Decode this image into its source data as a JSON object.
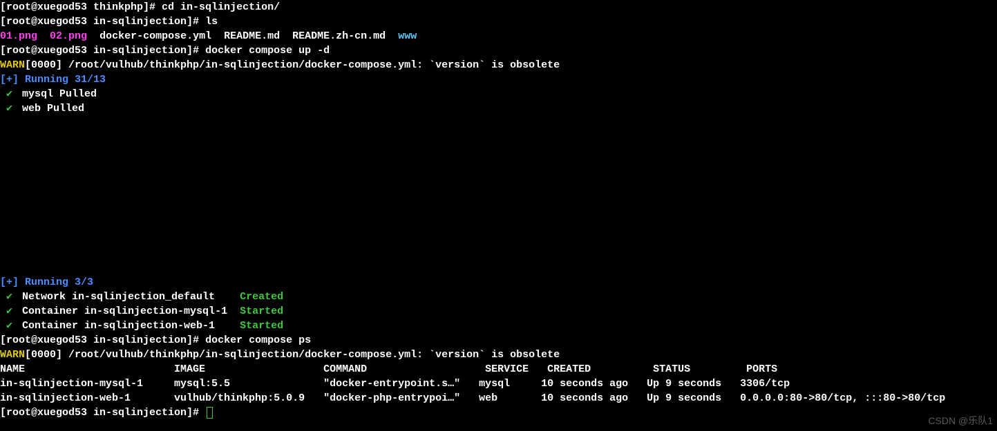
{
  "lines": {
    "l1_prompt": "[root@xuegod53 thinkphp]# ",
    "l1_cmd": "cd in-sqlinjection/",
    "l2_prompt": "[root@xuegod53 in-sqlinjection]# ",
    "l2_cmd": "ls",
    "l3_f1": "01.png",
    "l3_f2": "02.png",
    "l3_f3": "docker-compose.yml",
    "l3_f4": "README.md",
    "l3_f5": "README.zh-cn.md",
    "l3_f6": "www",
    "l4_prompt": "[root@xuegod53 in-sqlinjection]# ",
    "l4_cmd": "docker compose up -d",
    "l5_warn": "WARN",
    "l5_msg": "[0000] /root/vulhub/thinkphp/in-sqlinjection/docker-compose.yml: `version` is obsolete ",
    "l6": "[+] Running 31/13",
    "l7": " mysql Pulled ",
    "l8": " web Pulled ",
    "l9": "[+] Running 3/3",
    "l10_name": " Network in-sqlinjection_default    ",
    "l10_status": "Created",
    "l11_name": " Container in-sqlinjection-mysql-1  ",
    "l11_status": "Started",
    "l12_name": " Container in-sqlinjection-web-1    ",
    "l12_status": "Started",
    "l13_prompt": "[root@xuegod53 in-sqlinjection]# ",
    "l13_cmd": "docker compose ps",
    "l14_warn": "WARN",
    "l14_msg": "[0000] /root/vulhub/thinkphp/in-sqlinjection/docker-compose.yml: `version` is obsolete ",
    "l15": "NAME                        IMAGE                   COMMAND                   SERVICE   CREATED          STATUS         PORTS",
    "l16": "in-sqlinjection-mysql-1     mysql:5.5               \"docker-entrypoint.s…\"   mysql     10 seconds ago   Up 9 seconds   3306/tcp",
    "l17": "in-sqlinjection-web-1       vulhub/thinkphp:5.0.9   \"docker-php-entrypoi…\"   web       10 seconds ago   Up 9 seconds   0.0.0.0:80->80/tcp, :::80->80/tcp",
    "l18_prompt": "[root@xuegod53 in-sqlinjection]# "
  },
  "watermark": "CSDN @乐队1",
  "chart_data": {
    "type": "table",
    "headers": [
      "NAME",
      "IMAGE",
      "COMMAND",
      "SERVICE",
      "CREATED",
      "STATUS",
      "PORTS"
    ],
    "rows": [
      [
        "in-sqlinjection-mysql-1",
        "mysql:5.5",
        "\"docker-entrypoint.s…\"",
        "mysql",
        "10 seconds ago",
        "Up 9 seconds",
        "3306/tcp"
      ],
      [
        "in-sqlinjection-web-1",
        "vulhub/thinkphp:5.0.9",
        "\"docker-php-entrypoi…\"",
        "web",
        "10 seconds ago",
        "Up 9 seconds",
        "0.0.0.0:80->80/tcp, :::80->80/tcp"
      ]
    ]
  }
}
